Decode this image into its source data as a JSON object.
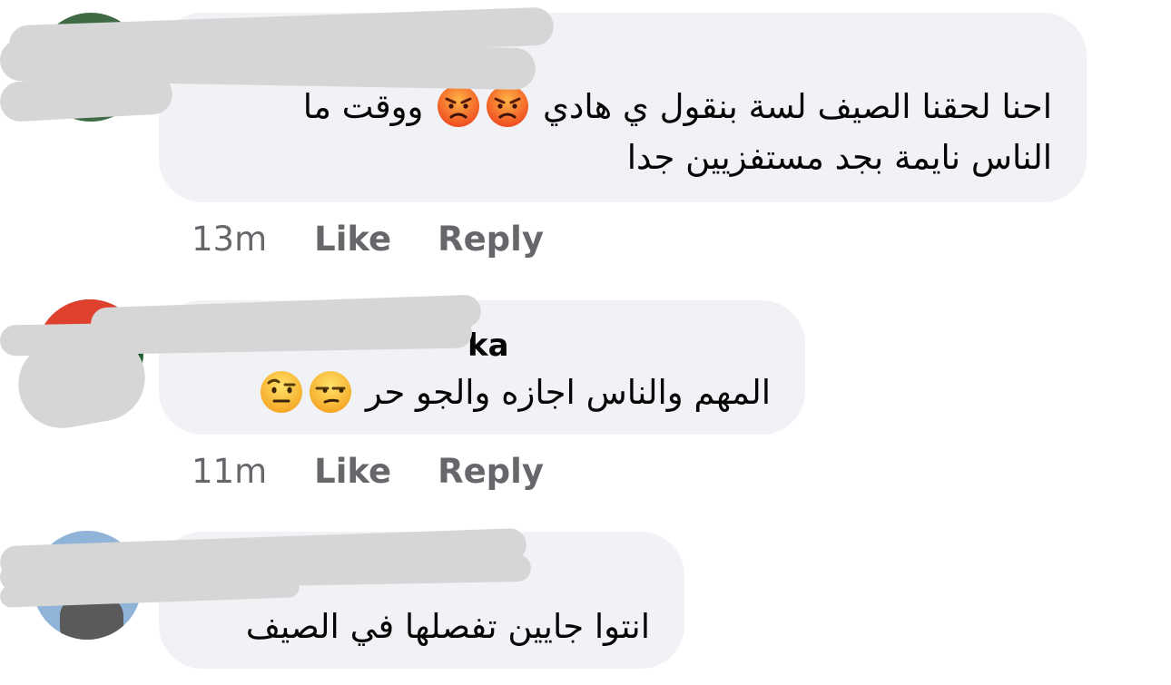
{
  "comments": [
    {
      "author": "",
      "line1": "احنا لحقنا الصيف لسة بنقول ي هادي",
      "line1_tail": "ووقت ما",
      "line2": "الناس نايمة بجد مستفزيين جدا",
      "emojis": [
        "angry-face",
        "angry-face"
      ],
      "time": "13m",
      "like": "Like",
      "reply": "Reply"
    },
    {
      "author": "ka",
      "line1": "المهم والناس اجازه والجو حر",
      "emojis": [
        "unamused-face",
        "raised-eyebrow-face"
      ],
      "time": "11m",
      "like": "Like",
      "reply": "Reply"
    },
    {
      "author": "",
      "line1": "انتوا جايين تفصلها في الصيف",
      "emojis": [],
      "time": "",
      "like": "",
      "reply": ""
    }
  ],
  "colors": {
    "bubble": "#f0f2f5",
    "meta_text": "#65676b",
    "body_text": "#050505",
    "redaction": "#d6d6d6"
  }
}
